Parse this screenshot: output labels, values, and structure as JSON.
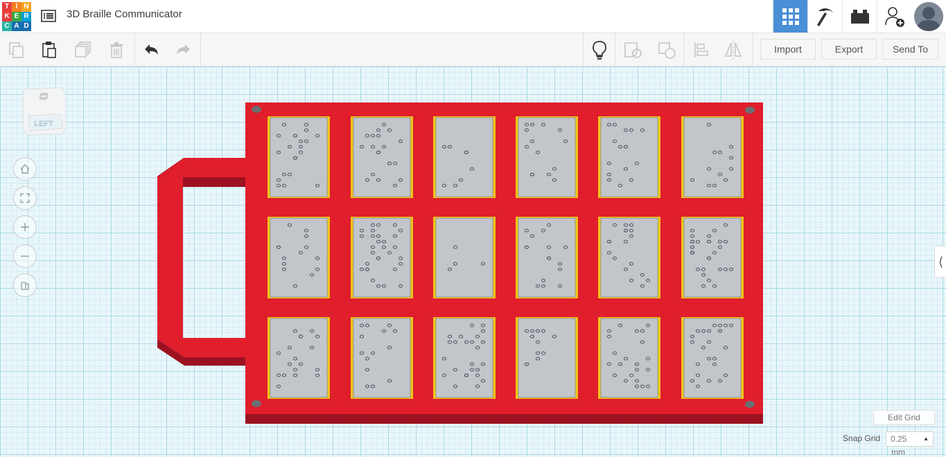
{
  "app": {
    "logo_letters": [
      "T",
      "I",
      "N",
      "K",
      "E",
      "R",
      "C",
      "A",
      "D"
    ],
    "logo_colors": [
      "#e93d3d",
      "#f58220",
      "#f5a623",
      "#e93d3d",
      "#39a845",
      "#00a0d6",
      "#2bb5a6",
      "#1a6fb0",
      "#1a6fb0"
    ],
    "title": "3D Braille Communicator"
  },
  "topbar": {
    "buttons": [
      {
        "icon": "grid-view-icon",
        "active": true
      },
      {
        "icon": "pickaxe-icon",
        "active": false
      },
      {
        "icon": "lego-brick-icon",
        "active": false
      },
      {
        "icon": "add-user-icon",
        "active": false
      }
    ]
  },
  "toolbar": {
    "import_label": "Import",
    "export_label": "Export",
    "send_to_label": "Send To"
  },
  "viewcube": {
    "face_label": "LEFT"
  },
  "grid": {
    "edit_grid_label": "Edit Grid",
    "snap_grid_label": "Snap Grid",
    "snap_grid_value": "0.25",
    "snap_grid_unit": "mm"
  },
  "colors": {
    "accent": "#4a8fd6",
    "model_red": "#e01e2c",
    "model_dark_red": "#9c1221",
    "tile_gray": "#c2c6ca",
    "tile_yellow": "#f0c419",
    "grid_bg": "#e9f6fa"
  }
}
